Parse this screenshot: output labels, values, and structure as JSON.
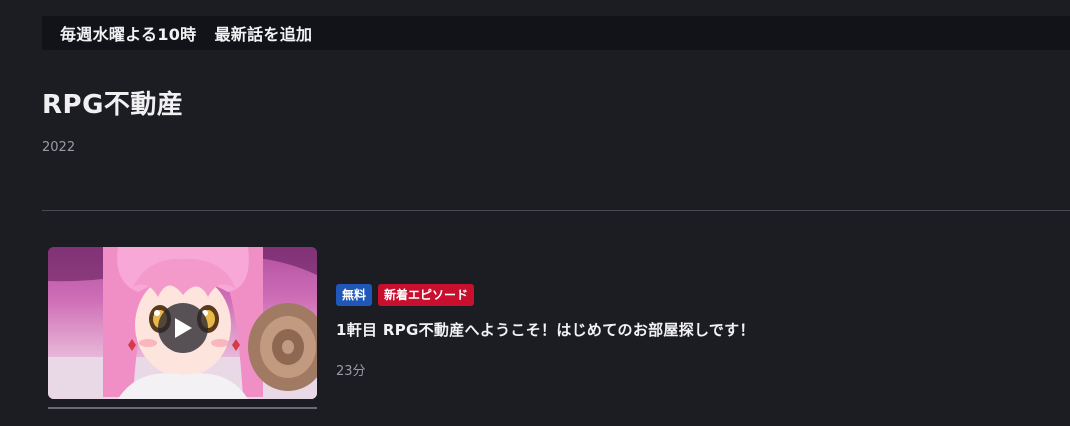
{
  "notice": {
    "schedule": "毎週水曜よる10時",
    "update": "最新話を追加"
  },
  "series": {
    "title": "RPG不動産",
    "year": "2022"
  },
  "episodes": [
    {
      "badges": [
        "無料",
        "新着エピソード"
      ],
      "title": "1軒目 RPG不動産へようこそ！はじめてのお部屋探しです！",
      "duration": "23分",
      "thumbnail_icon": "play-icon"
    }
  ],
  "colors": {
    "background": "#1c1d22",
    "badge_free": "#1f58b8",
    "badge_new": "#c8102e"
  }
}
